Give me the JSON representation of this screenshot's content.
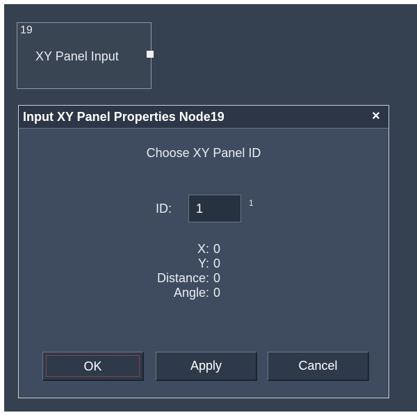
{
  "node": {
    "id": "19",
    "label": "XY Panel Input"
  },
  "dialog": {
    "title": "Input XY Panel Properties Node19",
    "close_label": "×",
    "choose_label": "Choose XY Panel ID",
    "id_label": "ID:",
    "id_value": "1",
    "id_suffix": "1",
    "readouts": [
      {
        "label": "X:",
        "value": "0"
      },
      {
        "label": "Y:",
        "value": "0"
      },
      {
        "label": "Distance:",
        "value": "0"
      },
      {
        "label": "Angle:",
        "value": "0"
      }
    ],
    "buttons": {
      "ok": "OK",
      "apply": "Apply",
      "cancel": "Cancel"
    }
  }
}
